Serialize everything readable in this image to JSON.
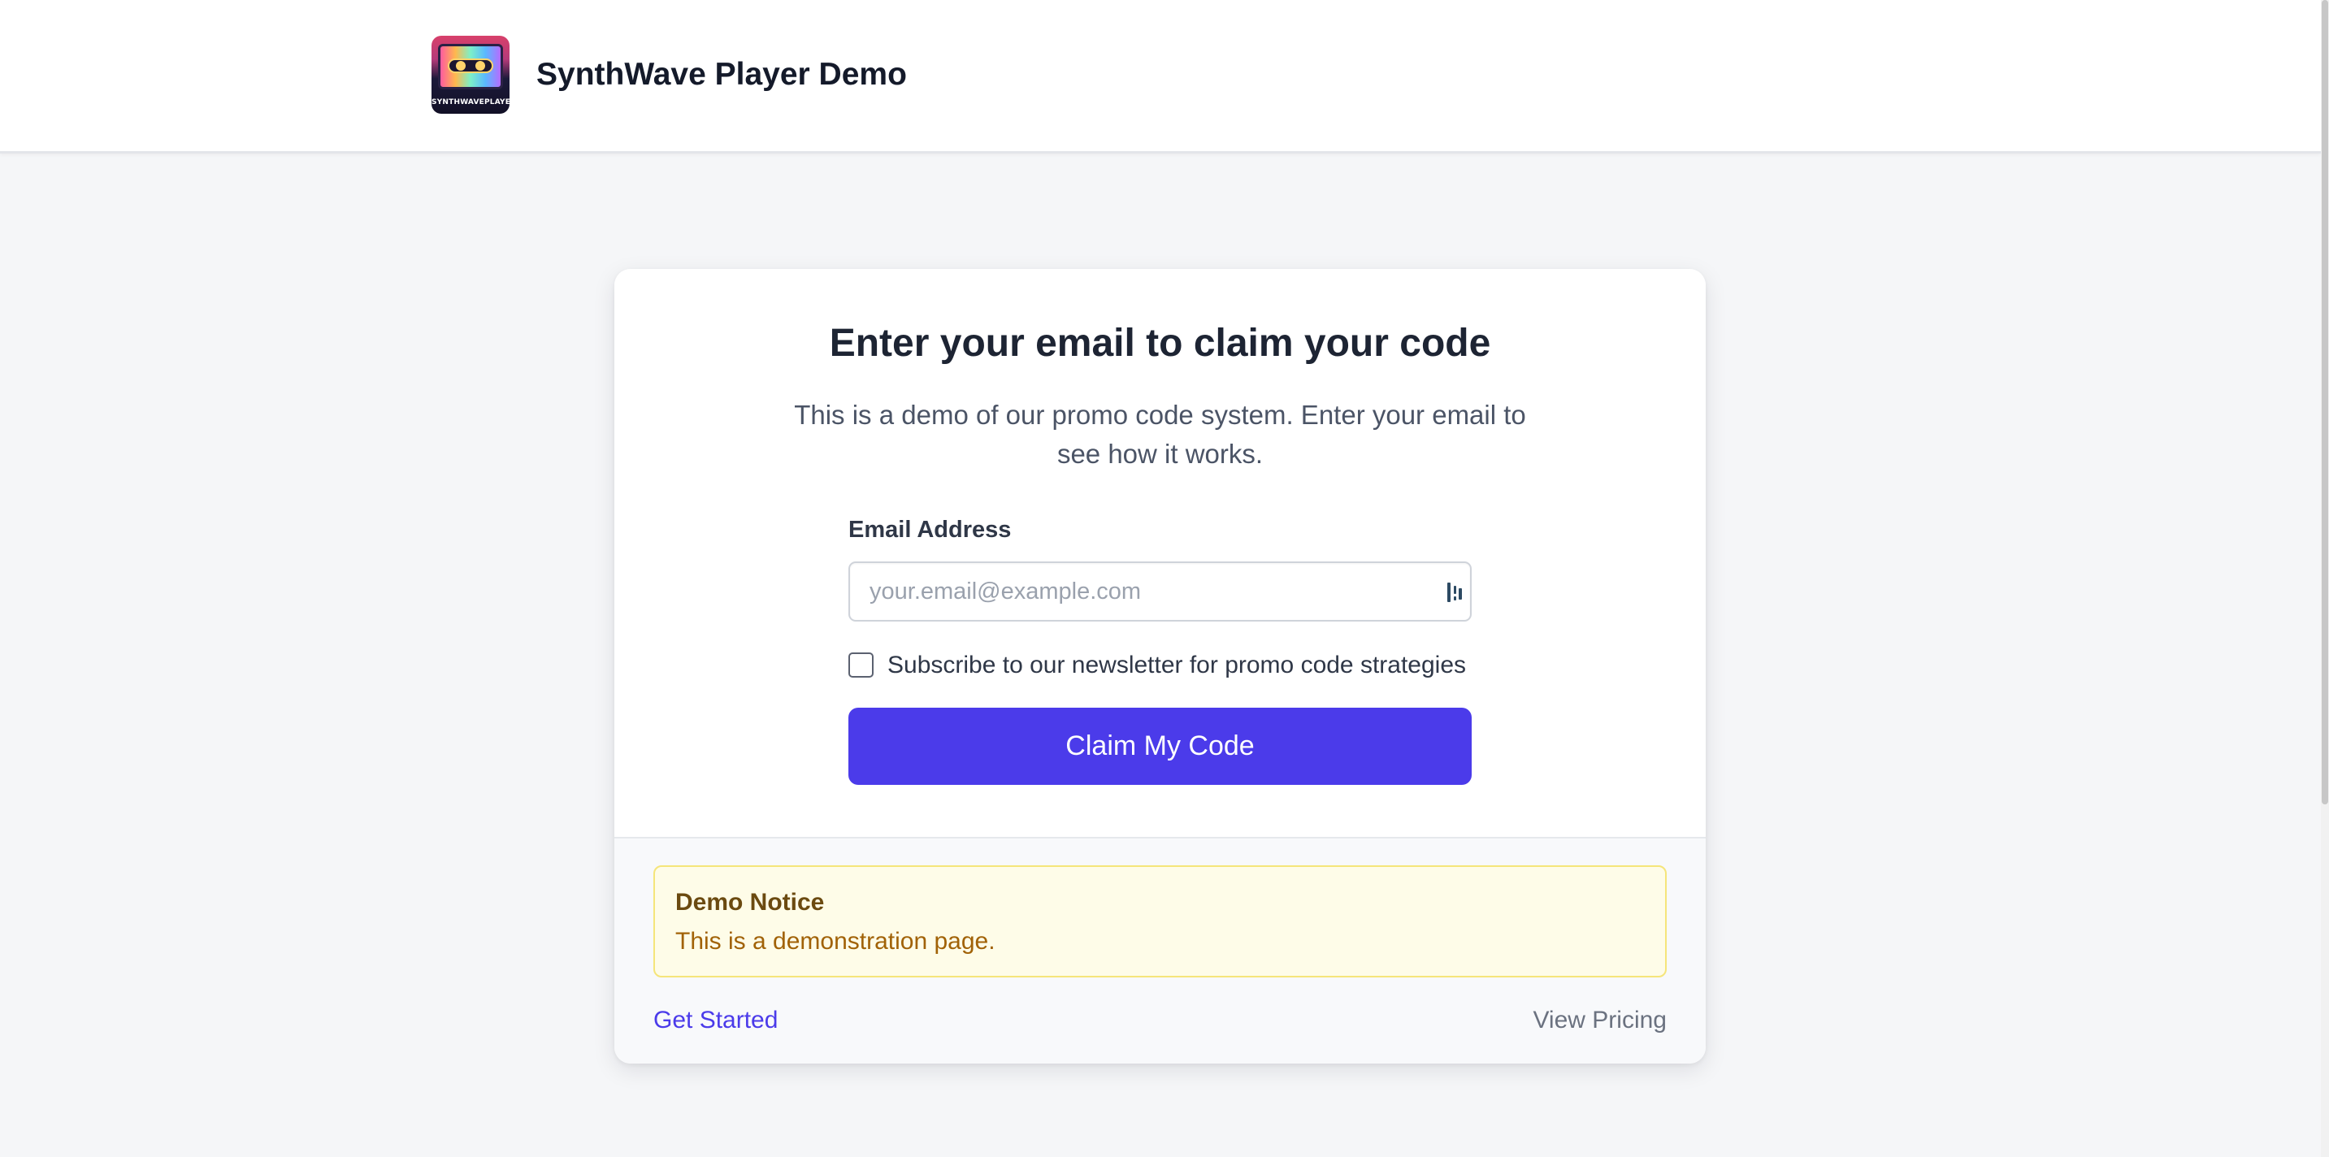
{
  "header": {
    "logo_text": "SYNTHWAVEPLAYER",
    "title": "SynthWave Player Demo"
  },
  "card": {
    "heading": "Enter your email to claim your code",
    "subtitle": "This is a demo of our promo code system. Enter your email to see how it works.",
    "email_label": "Email Address",
    "email_placeholder": "your.email@example.com",
    "email_value": "",
    "newsletter_label": "Subscribe to our newsletter for promo code strategies",
    "newsletter_checked": false,
    "claim_button": "Claim My Code"
  },
  "footer": {
    "notice_title": "Demo Notice",
    "notice_text": "This is a demonstration page.",
    "get_started": "Get Started",
    "view_pricing": "View Pricing"
  },
  "colors": {
    "accent": "#4b3bea",
    "notice_bg": "#fefce8",
    "notice_border": "#f5e57a",
    "notice_text": "#a16207"
  },
  "icons": {
    "logo": "cassette-logo-icon",
    "input_extension": "password-manager-icon"
  }
}
